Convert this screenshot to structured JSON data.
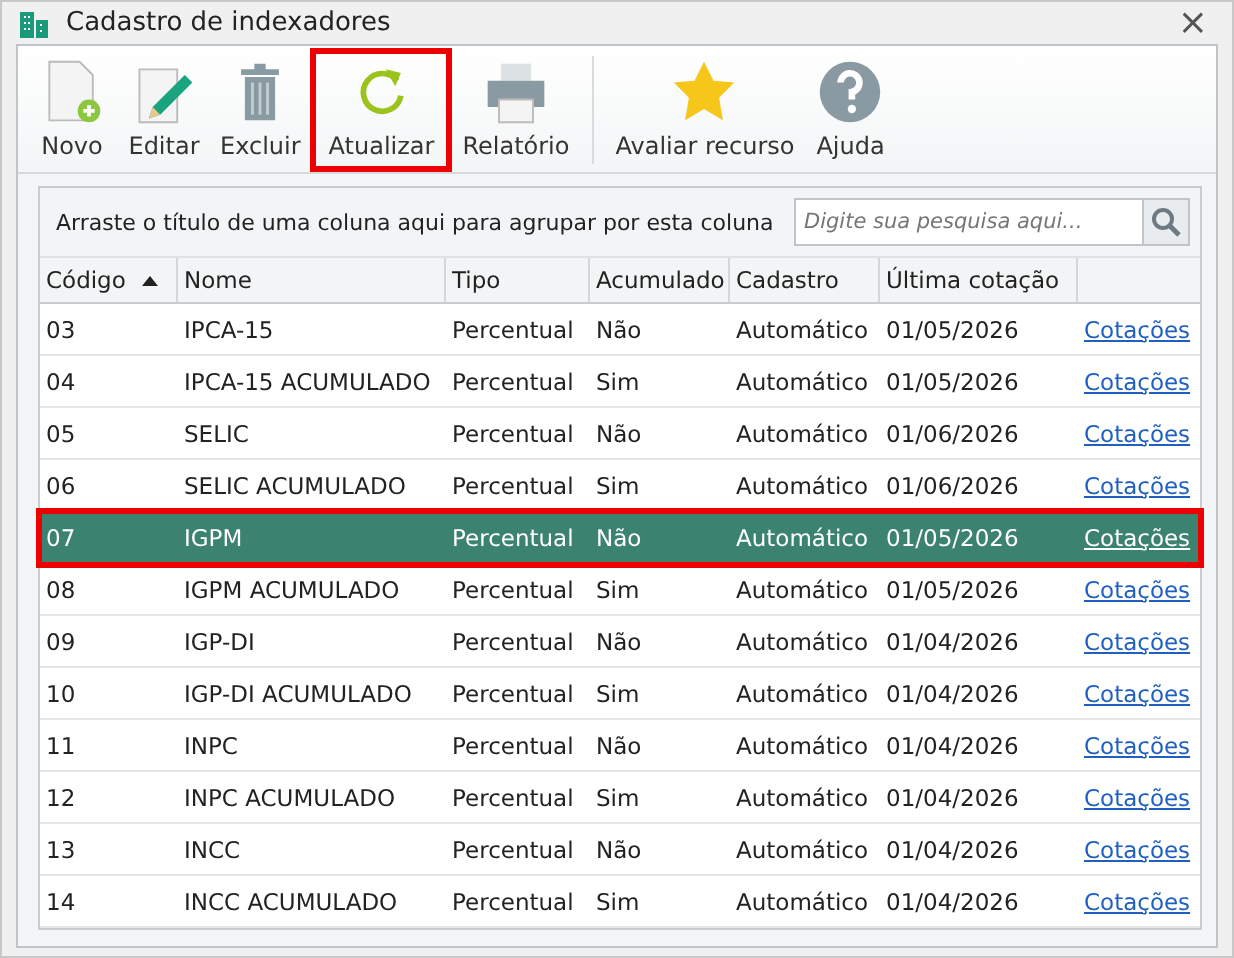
{
  "window": {
    "title": "Cadastro de indexadores",
    "close": "×"
  },
  "toolbar": [
    {
      "kind": "new",
      "label": "Novo",
      "highlighted": false
    },
    {
      "kind": "edit",
      "label": "Editar",
      "highlighted": false
    },
    {
      "kind": "delete",
      "label": "Excluir",
      "highlighted": false
    },
    {
      "kind": "refresh",
      "label": "Atualizar",
      "highlighted": true
    },
    {
      "kind": "print",
      "label": "Relatório",
      "highlighted": false
    },
    {
      "kind": "star",
      "label": "Avaliar recurso",
      "highlighted": false
    },
    {
      "kind": "help",
      "label": "Ajuda",
      "highlighted": false
    }
  ],
  "group_panel": {
    "hint": "Arraste o título de uma coluna aqui para agrupar por esta coluna"
  },
  "search": {
    "placeholder": "Digite sua pesquisa aqui..."
  },
  "table": {
    "columns": [
      {
        "label": "Código",
        "sorted": true
      },
      {
        "label": "Nome",
        "sorted": false
      },
      {
        "label": "Tipo",
        "sorted": false
      },
      {
        "label": "Acumulado",
        "sorted": false
      },
      {
        "label": "Cadastro",
        "sorted": false
      },
      {
        "label": "Última cotação",
        "sorted": false
      }
    ],
    "rows": [
      {
        "cells": [
          "03",
          "IPCA-15",
          "Percentual",
          "Não",
          "Automático",
          "01/05/2026"
        ],
        "link": "Cotações",
        "selected": false
      },
      {
        "cells": [
          "04",
          "IPCA-15 ACUMULADO",
          "Percentual",
          "Sim",
          "Automático",
          "01/05/2026"
        ],
        "link": "Cotações",
        "selected": false
      },
      {
        "cells": [
          "05",
          "SELIC",
          "Percentual",
          "Não",
          "Automático",
          "01/06/2026"
        ],
        "link": "Cotações",
        "selected": false
      },
      {
        "cells": [
          "06",
          "SELIC ACUMULADO",
          "Percentual",
          "Sim",
          "Automático",
          "01/06/2026"
        ],
        "link": "Cotações",
        "selected": false
      },
      {
        "cells": [
          "07",
          "IGPM",
          "Percentual",
          "Não",
          "Automático",
          "01/05/2026"
        ],
        "link": "Cotações",
        "selected": true
      },
      {
        "cells": [
          "08",
          "IGPM ACUMULADO",
          "Percentual",
          "Sim",
          "Automático",
          "01/05/2026"
        ],
        "link": "Cotações",
        "selected": false
      },
      {
        "cells": [
          "09",
          "IGP-DI",
          "Percentual",
          "Não",
          "Automático",
          "01/04/2026"
        ],
        "link": "Cotações",
        "selected": false
      },
      {
        "cells": [
          "10",
          "IGP-DI ACUMULADO",
          "Percentual",
          "Sim",
          "Automático",
          "01/04/2026"
        ],
        "link": "Cotações",
        "selected": false
      },
      {
        "cells": [
          "11",
          "INPC",
          "Percentual",
          "Não",
          "Automático",
          "01/04/2026"
        ],
        "link": "Cotações",
        "selected": false
      },
      {
        "cells": [
          "12",
          "INPC ACUMULADO",
          "Percentual",
          "Sim",
          "Automático",
          "01/04/2026"
        ],
        "link": "Cotações",
        "selected": false
      },
      {
        "cells": [
          "13",
          "INCC",
          "Percentual",
          "Não",
          "Automático",
          "01/04/2026"
        ],
        "link": "Cotações",
        "selected": false
      },
      {
        "cells": [
          "14",
          "INCC ACUMULADO",
          "Percentual",
          "Sim",
          "Automático",
          "01/04/2026"
        ],
        "link": "Cotações",
        "selected": false
      }
    ]
  }
}
